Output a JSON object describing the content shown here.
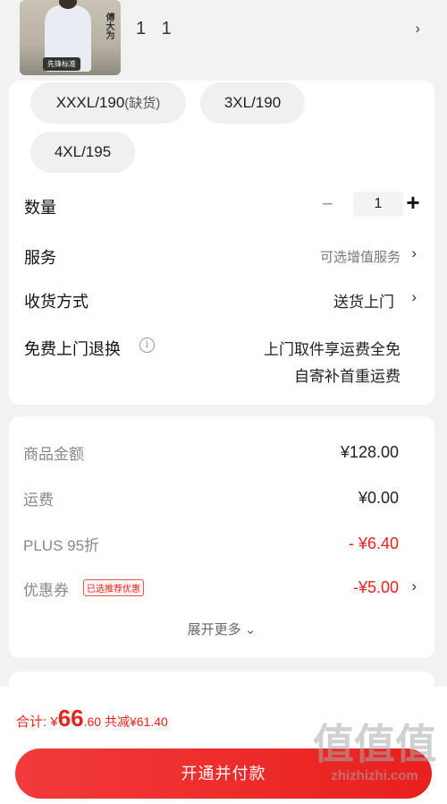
{
  "product": {
    "thumb_text": "傅大为",
    "thumb_tag": "先锋标准",
    "qty_label": "1 1",
    "chevron": "›"
  },
  "sizes": [
    {
      "label": "XXXL/190",
      "note": "(缺货)"
    },
    {
      "label": "3XL/190",
      "note": ""
    },
    {
      "label": "4XL/195",
      "note": ""
    }
  ],
  "quantity": {
    "label": "数量",
    "value": "1",
    "minus": "−",
    "plus": "+"
  },
  "service": {
    "label": "服务",
    "value": "可选增值服务"
  },
  "delivery": {
    "label": "收货方式",
    "value": "送货上门"
  },
  "returns": {
    "label": "免费上门退换",
    "line1": "上门取件享运费全免",
    "line2": "自寄补首重运费",
    "info_icon": "i"
  },
  "prices": {
    "goods_label": "商品金额",
    "goods_value": "¥128.00",
    "shipping_label": "运费",
    "shipping_value": "¥0.00",
    "plus_label": "PLUS 95折",
    "plus_value": "- ¥6.40",
    "coupon_label": "优惠券",
    "coupon_badge": "已选推荐优惠",
    "coupon_value": "-¥5.00",
    "expand_label": "展开更多 ⌄"
  },
  "footer": {
    "total_prefix": "合计: ¥",
    "total_int": "66",
    "total_dec": ".60",
    "saved": " 共减¥61.40",
    "pay_label": "开通并付款"
  },
  "watermark": {
    "glyphs": "值值值",
    "url": "zhizhizhi.com"
  },
  "colors": {
    "accent": "#e1251b",
    "button": "#ed2b28",
    "background": "#f2f2f2"
  }
}
